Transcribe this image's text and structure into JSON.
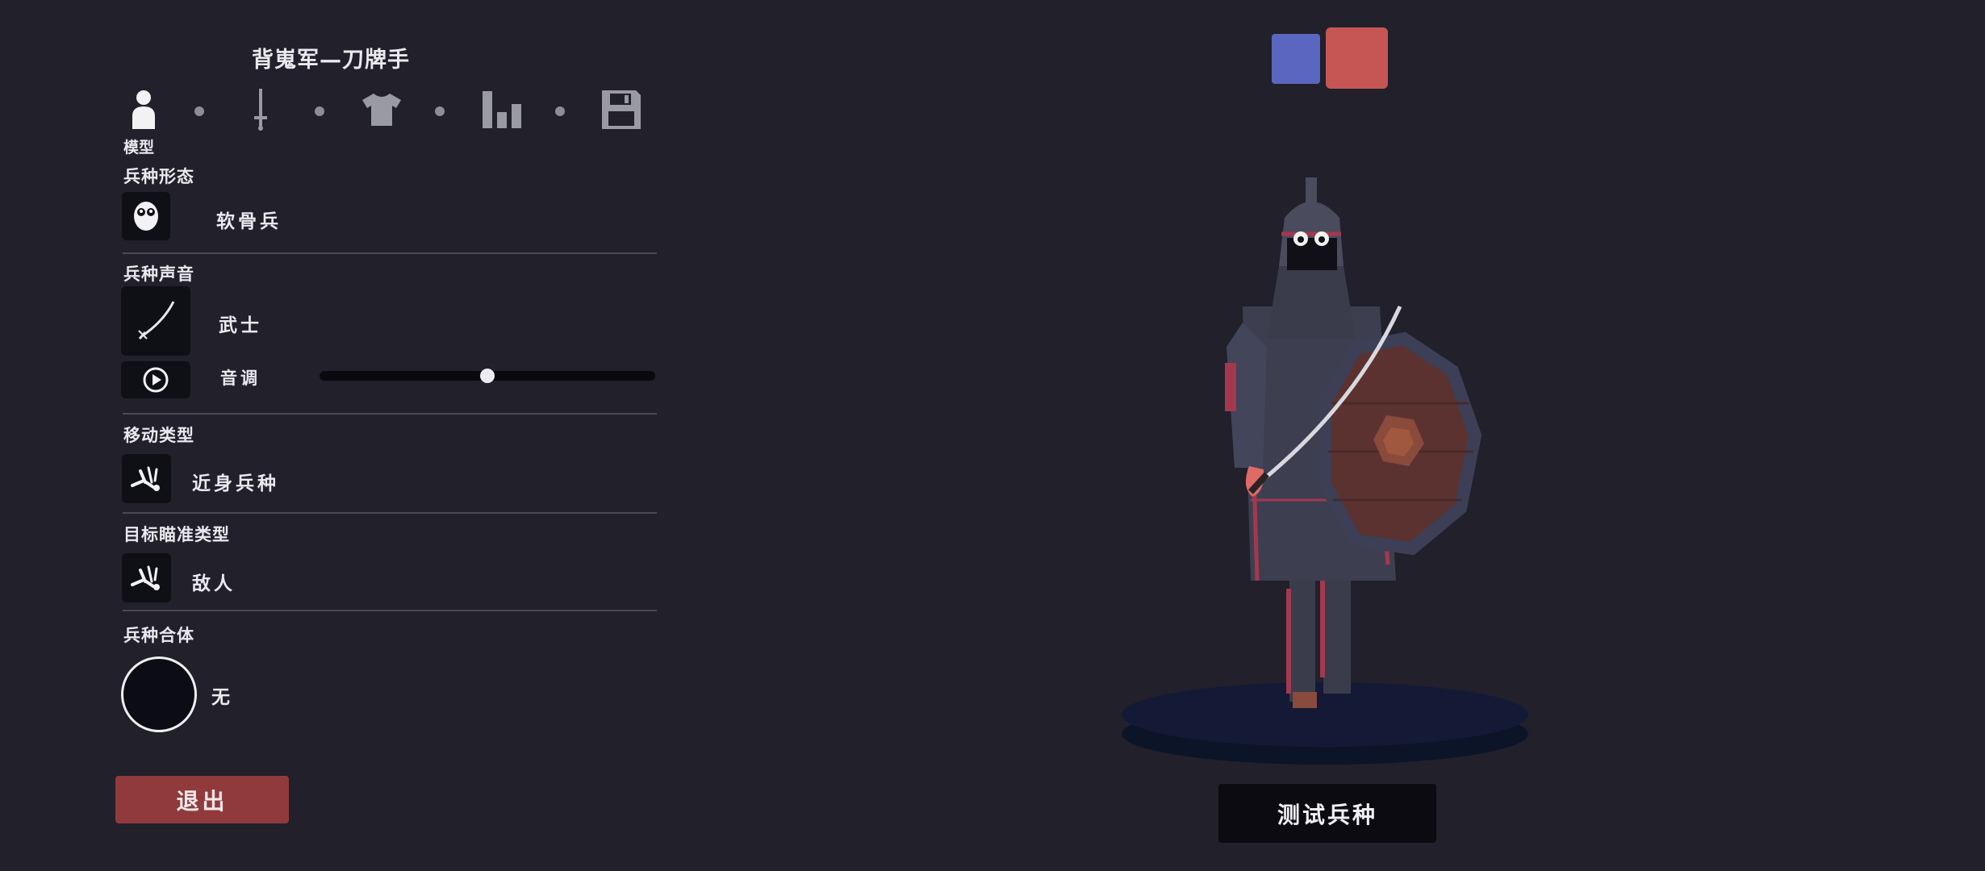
{
  "header": {
    "title": "背嵬军—刀牌手"
  },
  "tabs": [
    {
      "name": "model",
      "label": "模型",
      "icon": "person-icon",
      "active": true
    },
    {
      "name": "weapon",
      "icon": "sword-icon",
      "active": false
    },
    {
      "name": "clothing",
      "icon": "shirt-icon",
      "active": false
    },
    {
      "name": "stats",
      "icon": "bar-chart-icon",
      "active": false
    },
    {
      "name": "save",
      "icon": "save-icon",
      "active": false
    }
  ],
  "sections": {
    "unit_form": {
      "label": "兵种形态",
      "value": "软骨兵",
      "icon": "ragdoll-face-icon"
    },
    "unit_sound": {
      "label": "兵种声音",
      "value": "武士",
      "icon": "katana-icon",
      "pitch_label": "音调",
      "pitch_value": 0.5
    },
    "movement": {
      "label": "移动类型",
      "value": "近身兵种",
      "icon": "melee-unit-icon"
    },
    "targeting": {
      "label": "目标瞄准类型",
      "value": "敌人",
      "icon": "target-unit-icon"
    },
    "merge": {
      "label": "兵种合体",
      "value": "无"
    }
  },
  "buttons": {
    "exit": "退出",
    "test": "测试兵种"
  },
  "teams": {
    "blue": "#5a67c0",
    "red": "#c65654"
  },
  "colors": {
    "background": "#21202b",
    "accent_red": "#913a3c"
  }
}
